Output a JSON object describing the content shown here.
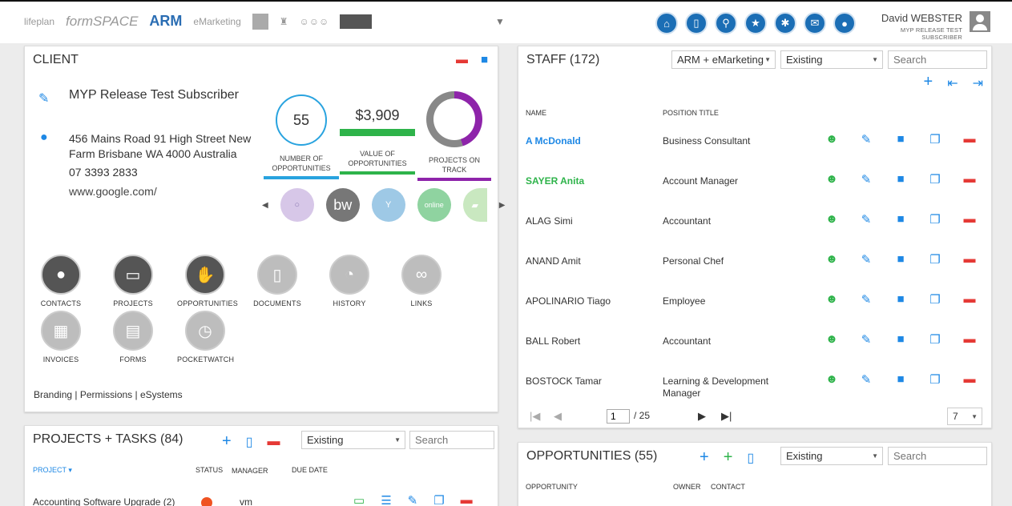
{
  "header": {
    "logos": [
      "lifeplan",
      "formSPACE",
      "ARM",
      "eMarketing"
    ],
    "user_name": "David WEBSTER",
    "user_subtitle": "MYP RELEASE TEST SUBSCRIBER"
  },
  "client": {
    "title": "CLIENT",
    "name": "MYP Release Test Subscriber",
    "address": "456 Mains Road 91 High Street New Farm Brisbane WA 4000 Australia",
    "phone": "07 3393 2833",
    "website": "www.google.com/",
    "stats": {
      "opportunities_count": "55",
      "opportunities_count_label": "NUMBER OF OPPORTUNITIES",
      "opportunities_value": "$3,909",
      "opportunities_value_label": "VALUE OF OPPORTUNITIES",
      "projects_label": "PROJECTS ON TRACK",
      "projects_on_track_fraction": 0.45
    },
    "carousel": [
      "bw",
      "online"
    ],
    "modules": [
      {
        "label": "CONTACTS"
      },
      {
        "label": "PROJECTS"
      },
      {
        "label": "OPPORTUNITIES"
      },
      {
        "label": "DOCUMENTS"
      },
      {
        "label": "HISTORY"
      },
      {
        "label": "LINKS"
      },
      {
        "label": "INVOICES"
      },
      {
        "label": "FORMS"
      },
      {
        "label": "POCKETWATCH"
      }
    ],
    "footer": "Branding | Permissions | eSystems"
  },
  "projects": {
    "title": "PROJECTS + TASKS (84)",
    "filter": "Existing",
    "search_placeholder": "Search",
    "columns": {
      "project": "PROJECT ▾",
      "status": "STATUS",
      "manager": "MANAGER",
      "due_date": "DUE DATE"
    },
    "rows": [
      {
        "name": "Accounting Software Upgrade (2)",
        "manager": "vm"
      }
    ]
  },
  "staff": {
    "title": "STAFF (172)",
    "filter_system": "ARM + eMarketing",
    "filter_status": "Existing",
    "search_placeholder": "Search",
    "columns": {
      "name": "NAME",
      "position": "POSITION TITLE"
    },
    "rows": [
      {
        "name": "A McDonald",
        "position": "Business Consultant"
      },
      {
        "name": "SAYER Anita",
        "position": "Account Manager"
      },
      {
        "name": "ALAG Simi",
        "position": "Accountant"
      },
      {
        "name": "ANAND Amit",
        "position": "Personal Chef"
      },
      {
        "name": "APOLINARIO Tiago",
        "position": "Employee"
      },
      {
        "name": "BALL Robert",
        "position": "Accountant"
      },
      {
        "name": "BOSTOCK Tamar",
        "position": "Learning & Development Manager"
      }
    ],
    "pager": {
      "page": "1",
      "total": "/ 25",
      "page_size": "7"
    }
  },
  "opportunities": {
    "title": "OPPORTUNITIES (55)",
    "filter": "Existing",
    "search_placeholder": "Search",
    "columns": {
      "opportunity": "OPPORTUNITY",
      "owner": "OWNER",
      "contact": "CONTACT"
    }
  },
  "colors": {
    "accent": "#1e88e5",
    "green": "#2eb34a",
    "red": "#e53935",
    "purple": "#8e24aa"
  }
}
